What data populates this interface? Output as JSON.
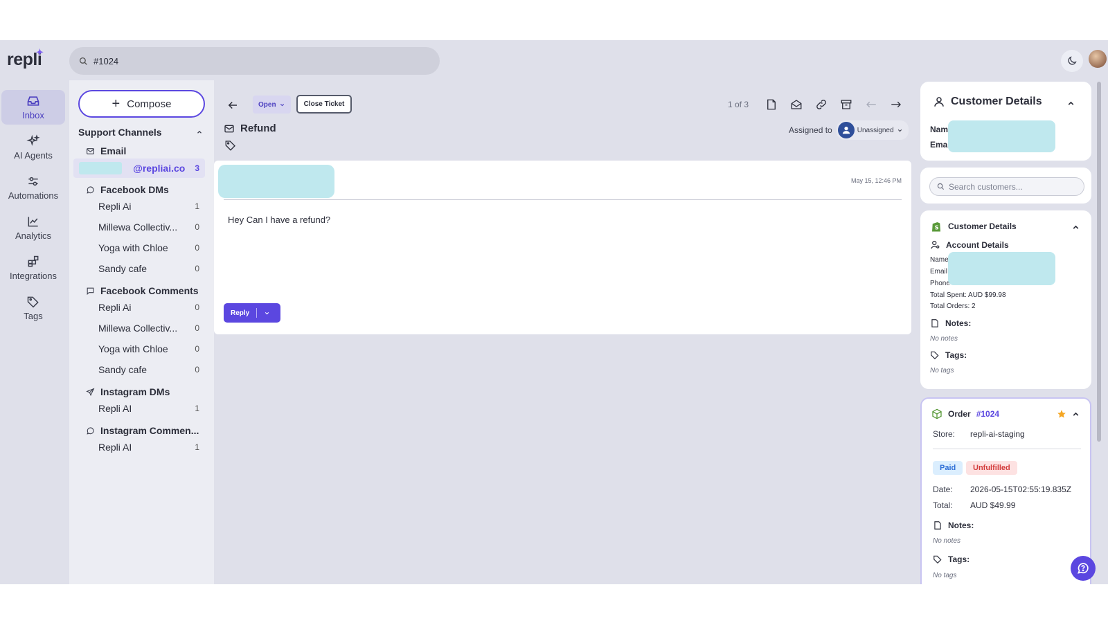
{
  "brand": {
    "name": "repli"
  },
  "search": {
    "value": "#1024"
  },
  "rail": [
    {
      "label": "Inbox",
      "active": true
    },
    {
      "label": "AI Agents"
    },
    {
      "label": "Automations"
    },
    {
      "label": "Analytics"
    },
    {
      "label": "Integrations"
    },
    {
      "label": "Tags"
    }
  ],
  "channels": {
    "compose_label": "Compose",
    "section_title": "Support Channels",
    "email": {
      "title": "Email",
      "item": {
        "label": "@repliai.co",
        "count": "3"
      }
    },
    "facebook_dms": {
      "title": "Facebook DMs",
      "items": [
        {
          "label": "Repli Ai",
          "count": "1"
        },
        {
          "label": "Millewa Collectiv...",
          "count": "0"
        },
        {
          "label": "Yoga with Chloe",
          "count": "0"
        },
        {
          "label": "Sandy cafe",
          "count": "0"
        }
      ]
    },
    "facebook_comments": {
      "title": "Facebook Comments",
      "items": [
        {
          "label": "Repli Ai",
          "count": "0"
        },
        {
          "label": "Millewa Collectiv...",
          "count": "0"
        },
        {
          "label": "Yoga with Chloe",
          "count": "0"
        },
        {
          "label": "Sandy cafe",
          "count": "0"
        }
      ]
    },
    "instagram_dms": {
      "title": "Instagram DMs",
      "items": [
        {
          "label": "Repli AI",
          "count": "1"
        }
      ]
    },
    "instagram_comments": {
      "title": "Instagram Commen...",
      "items": [
        {
          "label": "Repli AI",
          "count": "1"
        }
      ]
    }
  },
  "ticket": {
    "status": "Open",
    "close_label": "Close Ticket",
    "pager": "1 of 3",
    "subject": "Refund",
    "assigned_label": "Assigned to",
    "assignee": "Unassigned",
    "message": {
      "date": "May 15, 12:46 PM",
      "body": "Hey Can I have a refund?"
    },
    "reply_label": "Reply"
  },
  "customer": {
    "title": "Customer Details",
    "name_label": "Name",
    "email_label": "Email",
    "search_placeholder": "Search customers...",
    "shopify": {
      "title": "Customer Details",
      "account_title": "Account Details",
      "name_label": "Name",
      "email_label": "Email",
      "phone_label": "Phone",
      "total_spent": "Total Spent: AUD $99.98",
      "total_orders": "Total Orders: 2",
      "notes_label": "Notes:",
      "notes_value": "No notes",
      "tags_label": "Tags:",
      "tags_value": "No tags"
    }
  },
  "order": {
    "title": "Order",
    "number": "#1024",
    "store_label": "Store:",
    "store": "repli-ai-staging",
    "paid": "Paid",
    "fulfillment": "Unfulfilled",
    "date_label": "Date:",
    "date": "2026-05-15T02:55:19.835Z",
    "total_label": "Total:",
    "total": "AUD $49.99",
    "notes_label": "Notes:",
    "notes_value": "No notes",
    "tags_label": "Tags:",
    "tags_value": "No tags"
  },
  "colors": {
    "accent": "#5b47e0",
    "app_bg": "#dfe0ea",
    "star": "#f5a623",
    "paid_bg": "#dbeefe",
    "unfulfilled_bg": "#fde2e2"
  }
}
